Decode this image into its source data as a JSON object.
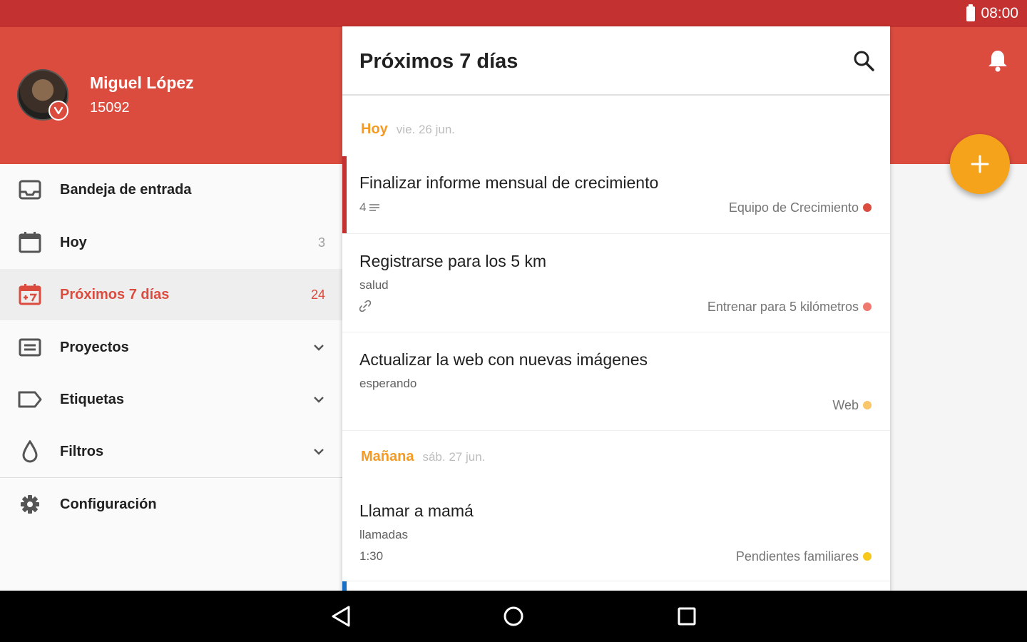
{
  "status_bar": {
    "time": "08:00"
  },
  "user": {
    "name": "Miguel López",
    "points": "15092"
  },
  "sidebar": {
    "items": [
      {
        "label": "Bandeja de entrada",
        "count": "",
        "icon": "inbox-icon"
      },
      {
        "label": "Hoy",
        "count": "3",
        "icon": "calendar-icon"
      },
      {
        "label": "Próximos 7 días",
        "count": "24",
        "icon": "calendar-plus7-icon",
        "active": true
      },
      {
        "label": "Proyectos",
        "count": "",
        "icon": "projects-icon"
      },
      {
        "label": "Etiquetas",
        "count": "",
        "icon": "label-icon"
      },
      {
        "label": "Filtros",
        "count": "",
        "icon": "drop-icon"
      },
      {
        "label": "Configuración",
        "count": "",
        "icon": "gear-icon"
      }
    ]
  },
  "main": {
    "title": "Próximos 7 días",
    "days": [
      {
        "name": "Hoy",
        "date": "vie. 26 jun."
      },
      {
        "name": "Mañana",
        "date": "sáb. 27 jun."
      }
    ],
    "tasks": [
      {
        "title": "Finalizar informe mensual de crecimiento",
        "notes": "4",
        "project": "Equipo de Crecimiento",
        "color": "#db4c3f"
      },
      {
        "title": "Registrarse para los 5 km",
        "label": "salud",
        "project": "Entrenar para 5 kilómetros",
        "color": "#f0796f"
      },
      {
        "title": "Actualizar la web con nuevas imágenes",
        "label": "esperando",
        "project": "Web",
        "color": "#fbc56a"
      },
      {
        "title": "Llamar a mamá",
        "label": "llamadas",
        "time": "1:30",
        "project": "Pendientes familiares",
        "color": "#f6c81c"
      }
    ]
  },
  "colors": {
    "status_bar": "#c33130",
    "header": "#db4c3f",
    "accent": "#f5a31a",
    "day_label": "#f59a23"
  }
}
